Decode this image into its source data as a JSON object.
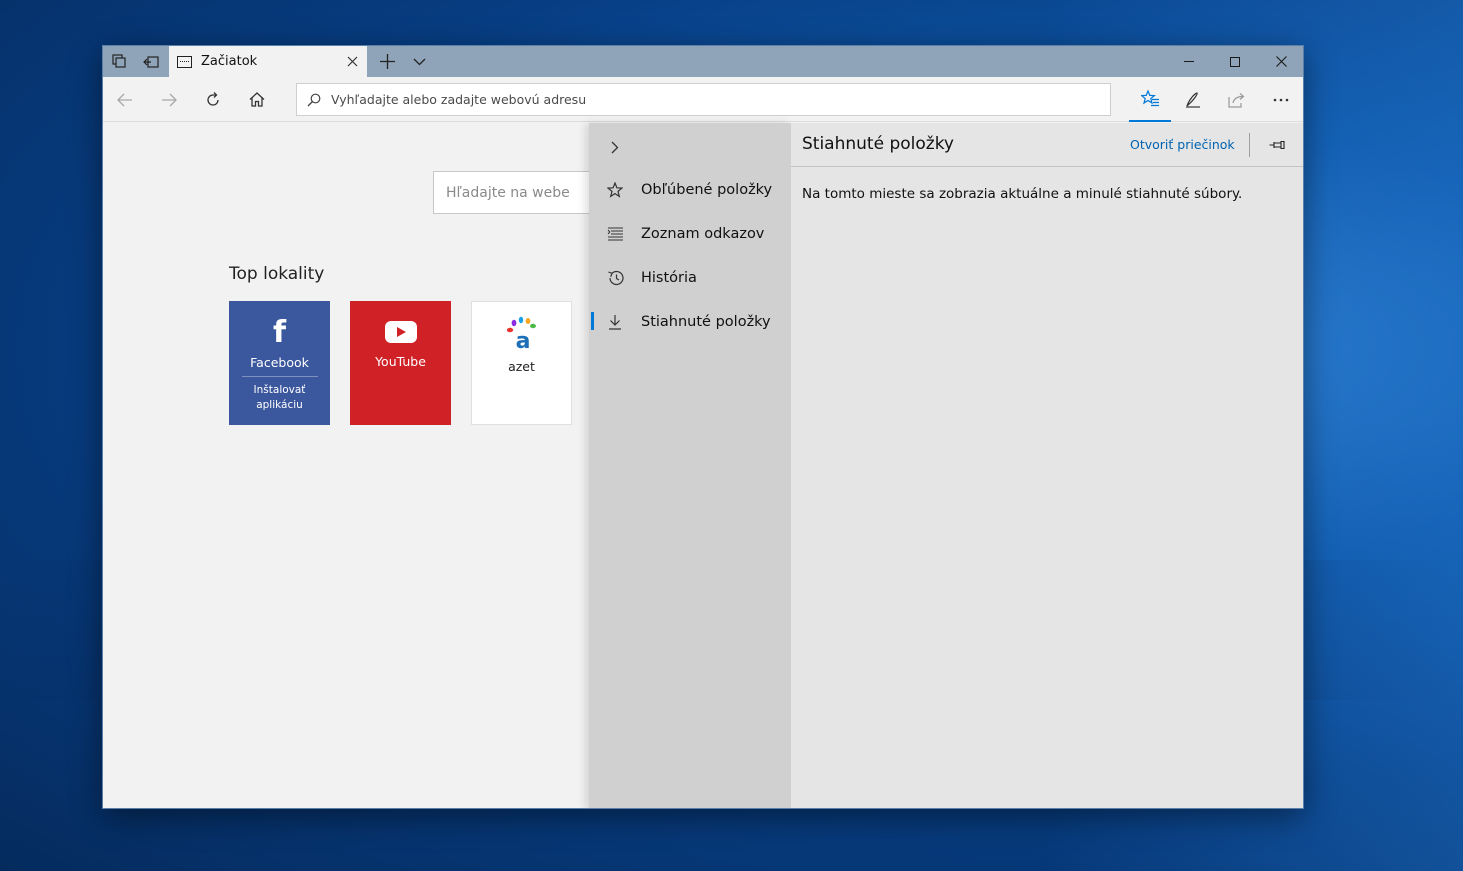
{
  "tab": {
    "title": "Začiatok"
  },
  "address_bar": {
    "placeholder": "Vyhľadajte alebo zadajte webovú adresu"
  },
  "page": {
    "search_placeholder": "Hľadajte na webe",
    "top_sites_title": "Top lokality",
    "tiles": [
      {
        "label": "Facebook",
        "sublabel": "Inštalovať aplikáciu",
        "color": "#3b579d"
      },
      {
        "label": "YouTube",
        "color": "#d02127"
      },
      {
        "label": "azet",
        "color": "#ffffff"
      }
    ]
  },
  "hub": {
    "items": [
      {
        "label": "Obľúbené položky",
        "icon": "star-icon"
      },
      {
        "label": "Zoznam odkazov",
        "icon": "reading-list-icon"
      },
      {
        "label": "História",
        "icon": "history-icon"
      },
      {
        "label": "Stiahnuté položky",
        "icon": "download-icon",
        "selected": true
      }
    ],
    "panel": {
      "title": "Stiahnuté položky",
      "open_folder": "Otvoriť priečinok",
      "message": "Na tomto mieste sa zobrazia aktuálne a minulé stiahnuté súbory."
    }
  },
  "colors": {
    "accent": "#0078d7",
    "tabbar": "#8fa4b9",
    "link": "#0063b1"
  }
}
